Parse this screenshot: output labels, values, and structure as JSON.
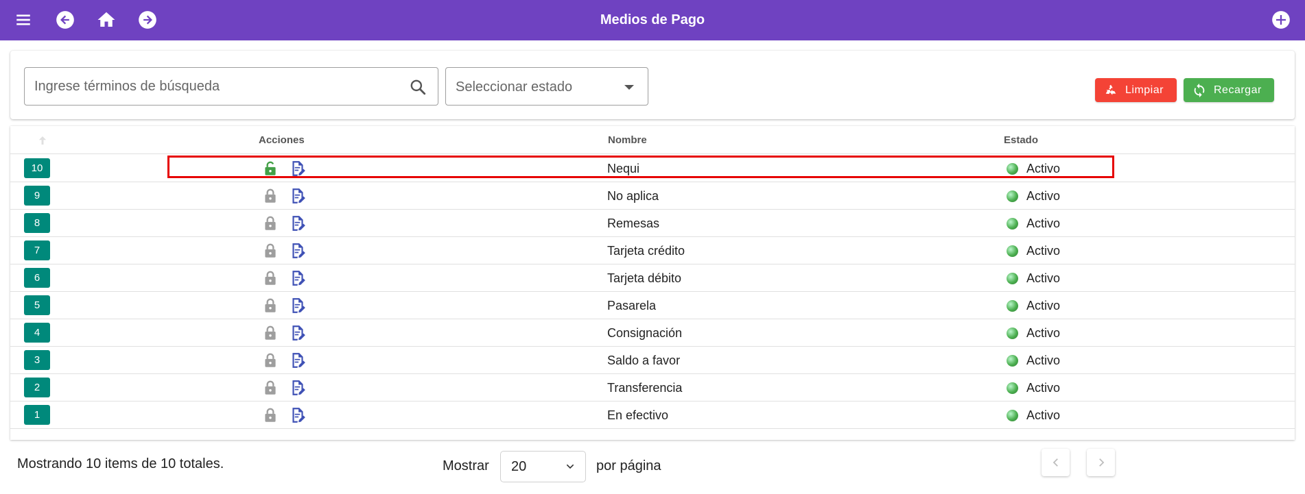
{
  "appbar": {
    "title": "Medios de Pago",
    "color": "#6f42c1"
  },
  "filters": {
    "search_placeholder": "Ingrese términos de búsqueda",
    "status_placeholder": "Seleccionar estado",
    "clear_label": "Limpiar",
    "reload_label": "Recargar"
  },
  "table": {
    "headers": {
      "actions": "Acciones",
      "name": "Nombre",
      "status": "Estado"
    },
    "rows": [
      {
        "id": "10",
        "name": "Nequi",
        "status": "Activo",
        "unlocked": true
      },
      {
        "id": "9",
        "name": "No aplica",
        "status": "Activo",
        "unlocked": false
      },
      {
        "id": "8",
        "name": "Remesas",
        "status": "Activo",
        "unlocked": false
      },
      {
        "id": "7",
        "name": "Tarjeta crédito",
        "status": "Activo",
        "unlocked": false
      },
      {
        "id": "6",
        "name": "Tarjeta débito",
        "status": "Activo",
        "unlocked": false
      },
      {
        "id": "5",
        "name": "Pasarela",
        "status": "Activo",
        "unlocked": false
      },
      {
        "id": "4",
        "name": "Consignación",
        "status": "Activo",
        "unlocked": false
      },
      {
        "id": "3",
        "name": "Saldo a favor",
        "status": "Activo",
        "unlocked": false
      },
      {
        "id": "2",
        "name": "Transferencia",
        "status": "Activo",
        "unlocked": false
      },
      {
        "id": "1",
        "name": "En efectivo",
        "status": "Activo",
        "unlocked": false
      }
    ]
  },
  "footer": {
    "count_text": "Mostrando 10 items de 10 totales.",
    "show_label": "Mostrar",
    "page_size": "20",
    "per_page_label": "por página"
  },
  "colors": {
    "badge": "#00897b",
    "clear": "#f44336",
    "reload": "#4caf50",
    "lock_unlocked": "#43a047",
    "lock_locked": "#9e9e9e",
    "edit": "#3f51b5",
    "highlight": "#e60000"
  },
  "icons": {
    "menu": "menu-icon",
    "back": "arrow-left-icon",
    "home": "home-icon",
    "forward": "arrow-right-icon",
    "add": "plus-circle-icon",
    "search": "search-icon",
    "lock": "lock-icon",
    "edit": "edit-document-icon"
  }
}
